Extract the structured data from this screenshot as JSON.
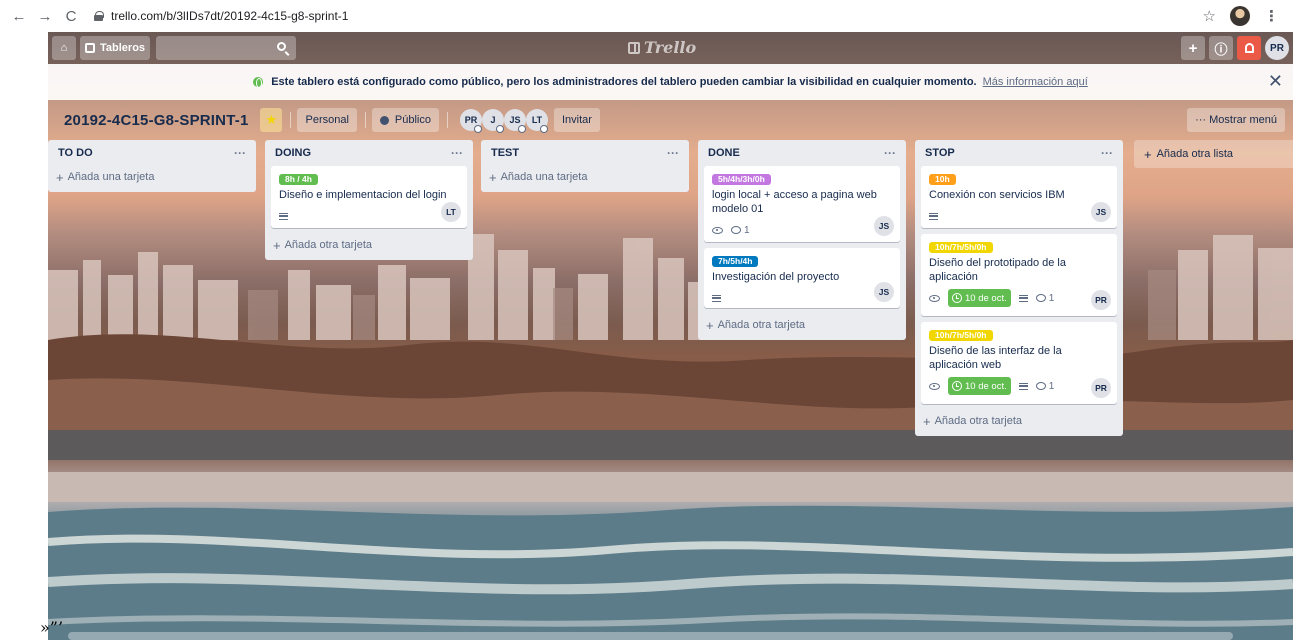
{
  "browser": {
    "url": "trello.com/b/3lIDs7dt/20192-4c15-g8-sprint-1",
    "back_glyph": "←",
    "forward_glyph": "→",
    "reload_glyph": "C",
    "bookmark_glyph": "☆",
    "menu_glyph": "⋮"
  },
  "header": {
    "home_glyph": "⌂",
    "boards_label": "Tableros",
    "logo_text": "Trello",
    "plus_glyph": "+",
    "info_glyph": "ⓘ",
    "bell_glyph": "🔔",
    "user_initials": "PR"
  },
  "notice": {
    "text": "Este tablero está configurado como público, pero los administradores del tablero pueden cambiar la visibilidad en cualquier momento.",
    "link": "Más información aquí",
    "close_glyph": "✕"
  },
  "board": {
    "title": "20192-4C15-G8-SPRINT-1",
    "star_glyph": "★",
    "team": "Personal",
    "visibility": "Público",
    "members": [
      "PR",
      "J",
      "JS",
      "LT"
    ],
    "invite": "Invitar",
    "show_menu": "··· Mostrar menú",
    "add_list": "Añada otra lista"
  },
  "lists": [
    {
      "title": "TO DO",
      "dots": "···",
      "add_card": "Añada una tarjeta"
    },
    {
      "title": "DOING",
      "dots": "···",
      "add_card": "Añada otra tarjeta",
      "cards": [
        {
          "label": "8h / 4h",
          "label_color": "#61bd4f",
          "title": "Diseño e implementacion del login",
          "member": "LT"
        }
      ]
    },
    {
      "title": "TEST",
      "dots": "···",
      "add_card": "Añada una tarjeta"
    },
    {
      "title": "DONE",
      "dots": "···",
      "add_card": "Añada otra tarjeta",
      "cards": [
        {
          "label": "5h/4h/3h/0h",
          "label_color": "#c377e0",
          "title": "login local + acceso a pagina web modelo 01",
          "comments": "1",
          "member": "JS"
        },
        {
          "label": "7h/5h/4h",
          "label_color": "#0079bf",
          "title": "Investigación del proyecto",
          "member": "JS"
        }
      ]
    },
    {
      "title": "STOP",
      "dots": "···",
      "add_card": "Añada otra tarjeta",
      "cards": [
        {
          "label": "10h",
          "label_color": "#ff9f1a",
          "title": "Conexión con servicios IBM",
          "member": "JS"
        },
        {
          "label": "10h/7h/5h/0h",
          "label_color": "#f2d600",
          "title": "Diseño del prototipado de la aplicación",
          "due": "10 de oct.",
          "comments": "1",
          "member": "PR"
        },
        {
          "label": "10h/7h/5h/0h",
          "label_color": "#f2d600",
          "title": "Diseño de las interfaz de la aplicación web",
          "due": "10 de oct.",
          "comments": "1",
          "member": "PR"
        }
      ]
    }
  ],
  "edge_artifact": "»”’"
}
